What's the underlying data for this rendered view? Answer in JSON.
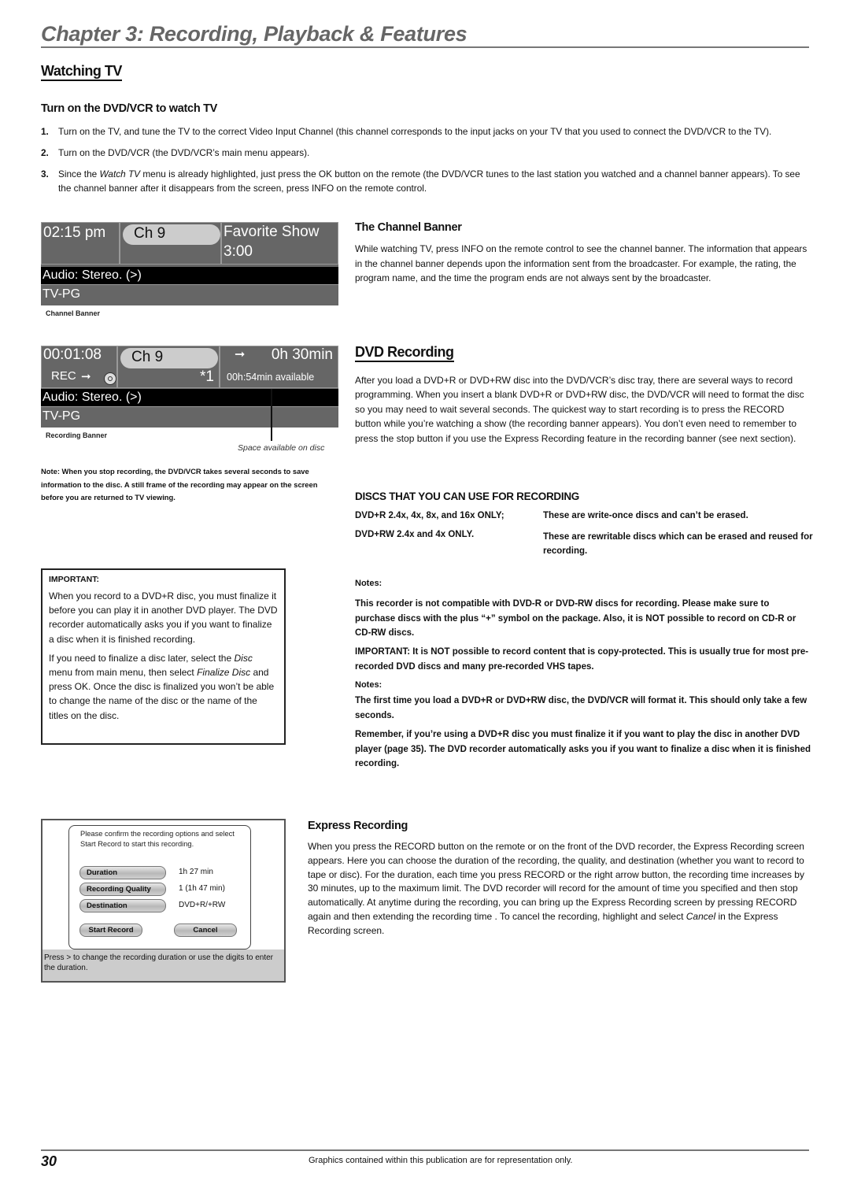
{
  "header": {
    "chapter_title": "Chapter 3: Recording, Playback & Features"
  },
  "watching_tv": {
    "heading": "Watching TV",
    "subheading": "Turn on the DVD/VCR to watch TV",
    "steps": [
      {
        "num": "1.",
        "text": "Turn on the TV, and tune the TV to the correct Video Input Channel (this channel corresponds to the input jacks on your TV that you used to connect the DVD/VCR to the TV)."
      },
      {
        "num": "2.",
        "text": "Turn on the DVD/VCR (the DVD/VCR’s main menu appears)."
      },
      {
        "num": "3.",
        "text_before": "Since the ",
        "text_italic": "Watch TV",
        "text_after": " menu is already highlighted, just press the OK button on the remote (the DVD/VCR tunes to the last station you watched and a channel banner appears). To see the channel banner after it disappears from the screen, press INFO on the remote control."
      }
    ]
  },
  "channel_banner_graphic": {
    "time": "02:15 pm",
    "channel": "Ch 9",
    "program": "Favorite Show",
    "end_time": "3:00",
    "audio": "Audio: Stereo. (>)",
    "rating": "TV-PG",
    "caption": "Channel Banner"
  },
  "recording_banner_graphic": {
    "elapsed": "00:01:08",
    "rec_label": "REC",
    "channel": "Ch 9",
    "marker": "*1",
    "duration": "0h 30min",
    "available": "00h:54min available",
    "audio": "Audio: Stereo. (>)",
    "rating": "TV-PG",
    "caption": "Recording Banner",
    "callout": "Space available on disc"
  },
  "recording_note": "Note: When you stop recording, the DVD/VCR takes several seconds to save information to the disc. A still frame of the recording may appear on the screen before you are returned to TV viewing.",
  "channel_banner_section": {
    "heading": "The Channel Banner",
    "body": "While watching TV, press INFO on the remote control to see the channel banner. The information that appears in the channel banner depends upon the information sent from the broadcaster. For example, the rating, the program name, and the time the program ends are not always sent by the broadcaster."
  },
  "dvd_recording": {
    "heading": "DVD Recording",
    "body": "After you load a DVD+R or DVD+RW disc into the DVD/VCR’s disc tray, there are several ways to record programming. When you insert a blank DVD+R or DVD+RW disc, the DVD/VCR will need to format the disc so you may need to wait several seconds. The quickest way to start recording is to press the RECORD button while you’re watching a show (the recording banner appears). You don’t even need to remember to press the stop button if you use the Express Recording feature in the recording banner (see next section).",
    "discs_heading": "DISCS THAT YOU CAN USE FOR RECORDING",
    "discs": [
      {
        "type": "DVD+R 2.4x, 4x, 8x, and 16x ONLY;",
        "desc": "These are write-once discs and can’t be erased."
      },
      {
        "type": "DVD+RW 2.4x and 4x ONLY.",
        "desc": "These are rewritable discs which can be erased and reused for recording."
      }
    ],
    "notes1_label": "Notes:",
    "notes1": [
      "This recorder is not compatible with DVD-R or DVD-RW discs for recording. Please make sure to purchase discs with the plus “+” symbol on the package. Also, it is NOT possible to record on CD-R or CD-RW discs.",
      "IMPORTANT: It is NOT possible to record content that is copy-protected. This is usually true for most pre-recorded DVD discs and many pre-recorded VHS tapes."
    ],
    "notes2_label": "Notes:",
    "notes2": [
      "The first time you load a DVD+R or DVD+RW disc, the DVD/VCR will format it. This should only take a few seconds.",
      "Remember, if you’re using a DVD+R disc you must finalize it if you want to play the disc in another DVD player (page 35). The DVD recorder automatically asks you if you want to finalize a disc when it is finished recording."
    ]
  },
  "important_box": {
    "label": "IMPORTANT:",
    "p1": "When you record to a DVD+R disc, you must finalize it before you can play it in another DVD player. The DVD recorder automatically asks you if you want to finalize a disc when it is finished recording.",
    "p2_a": "If you need to finalize a disc later, select the ",
    "p2_i1": "Disc",
    "p2_b": " menu from main menu, then select ",
    "p2_i2": "Finalize Disc",
    "p2_c": " and press OK. Once the disc is finalized you won’t be able to change the name of the disc or the name of the titles on the disc."
  },
  "express_screen": {
    "prompt": "Please confirm the recording options and select Start Record to start this recording.",
    "rows": [
      {
        "label": "Duration",
        "value": "1h 27 min"
      },
      {
        "label": "Recording Quality",
        "value": "1 (1h 47 min)"
      },
      {
        "label": "Destination",
        "value": "DVD+R/+RW"
      }
    ],
    "start_label": "Start Record",
    "cancel_label": "Cancel",
    "footer": "Press > to change the recording duration or use the digits to enter the duration."
  },
  "express_recording": {
    "heading": "Express Recording",
    "body_a": "When you press the RECORD button on the remote or on the front of the DVD recorder, the Express Recording screen appears.  Here you can choose the duration of the recording, the quality, and destination (whether you want to record to tape or disc). For the duration, each time you press RECORD or the right arrow button, the recording time increases by 30 minutes, up to the maximum limit. The DVD recorder will record for the amount of time you specified and then stop automatically. At anytime during the recording, you can bring up the Express Recording screen by pressing RECORD again and then extending the recording time . To cancel the recording, highlight and select ",
    "body_italic": "Cancel",
    "body_b": " in the Express Recording screen."
  },
  "footer": {
    "page_number": "30",
    "note": "Graphics contained within this publication are for representation only."
  }
}
